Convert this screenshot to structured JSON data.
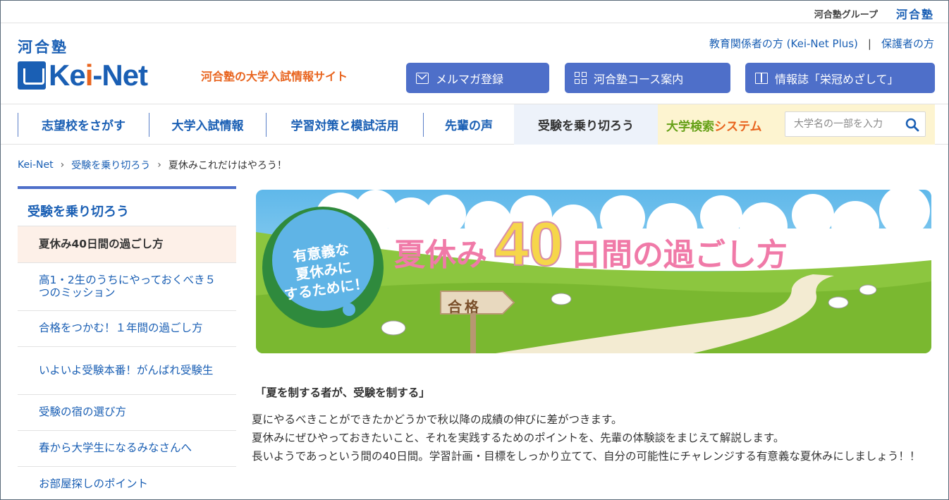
{
  "header": {
    "group_text": "河合塾グループ",
    "group_logo": "河合塾",
    "brand_kanji": "河合塾",
    "logo_text_1": "Ke",
    "logo_text_2": "i",
    "logo_text_3": "-Net",
    "tagline": "河合塾の大学入試情報サイト",
    "links": [
      "教育関係者の方 (Kei-Net Plus)",
      "保護者の方"
    ],
    "link_separator": "|",
    "buttons": [
      {
        "label": "メルマガ登録",
        "icon": "mail-icon"
      },
      {
        "label": "河合塾コース案内",
        "icon": "grid-icon"
      },
      {
        "label": "情報誌「栄冠めざして」",
        "icon": "book-icon"
      }
    ]
  },
  "nav": {
    "items": [
      "志望校をさがす",
      "大学入試情報",
      "学習対策と模試活用",
      "先輩の声",
      "受験を乗り切ろう"
    ],
    "active_index": 4,
    "search_label_1": "大学検索",
    "search_label_2": "システム",
    "search_placeholder": "大学名の一部を入力"
  },
  "breadcrumb": [
    "Kei-Net",
    "受験を乗り切ろう",
    "夏休みこれだけはやろう！"
  ],
  "sidebar": {
    "title": "受験を乗り切ろう",
    "items": [
      "夏休み40日間の過ごし方",
      "高1・2生のうちにやっておくべき５つのミッション",
      "合格をつかむ！１年間の過ごし方",
      "いよいよ受験本番！がんばれ受験生",
      "受験の宿の選び方",
      "春から大学生になるみなさんへ",
      "お部屋探しのポイント"
    ],
    "active_index": 0
  },
  "banner": {
    "bubble_lines": [
      "有意義な",
      "夏休みに",
      "するために！"
    ],
    "headline_1": "夏休み",
    "headline_num": "40",
    "headline_2": "日間の過ごし方",
    "sign": "合格"
  },
  "content": {
    "lead": "「夏を制する者が、受験を制する」",
    "paragraphs": [
      "夏にやるべきことができたかどうかで秋以降の成績の伸びに差がつきます。",
      "夏休みにぜひやっておきたいこと、それを実践するためのポイントを、先輩の体験談をまじえて解説します。",
      "長いようであっという間の40日間。学習計画・目標をしっかり立てて、自分の可能性にチャレンジする有意義な夏休みにしましょう！！"
    ]
  },
  "colors": {
    "brand_blue": "#1a5fb4",
    "accent_orange": "#e8641e",
    "button_blue": "#4e6fc9",
    "search_green": "#65a017"
  }
}
